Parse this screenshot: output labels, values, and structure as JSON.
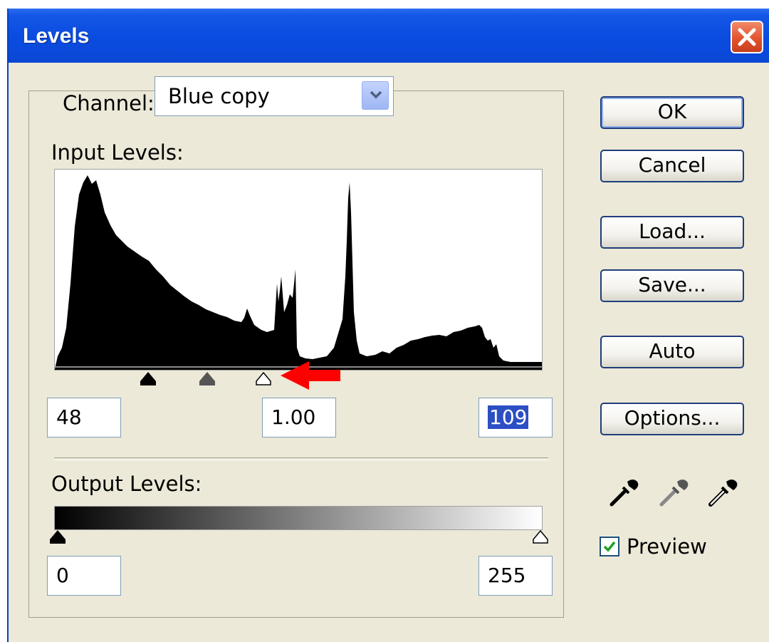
{
  "window": {
    "title": "Levels"
  },
  "channel": {
    "label": "Channel:",
    "value": "Blue copy"
  },
  "input_levels": {
    "label": "Input Levels:",
    "black": "48",
    "gamma": "1.00",
    "white": "109"
  },
  "output_levels": {
    "label": "Output Levels:",
    "black": "0",
    "white": "255"
  },
  "buttons": {
    "ok": "OK",
    "cancel": "Cancel",
    "load": "Load...",
    "save": "Save...",
    "auto": "Auto",
    "options": "Options..."
  },
  "preview": {
    "label": "Preview",
    "checked": true
  },
  "colors": {
    "titlebar": "#0a4be0",
    "dialog_bg": "#ece9d8",
    "selection": "#2c4fc4",
    "annotation_arrow": "#ff0000"
  },
  "icons": [
    "close-icon",
    "dropdown-chevron-icon",
    "black-eyedropper-icon",
    "gray-eyedropper-icon",
    "white-eyedropper-icon",
    "checkmark-icon",
    "red-arrow-annotation"
  ]
}
